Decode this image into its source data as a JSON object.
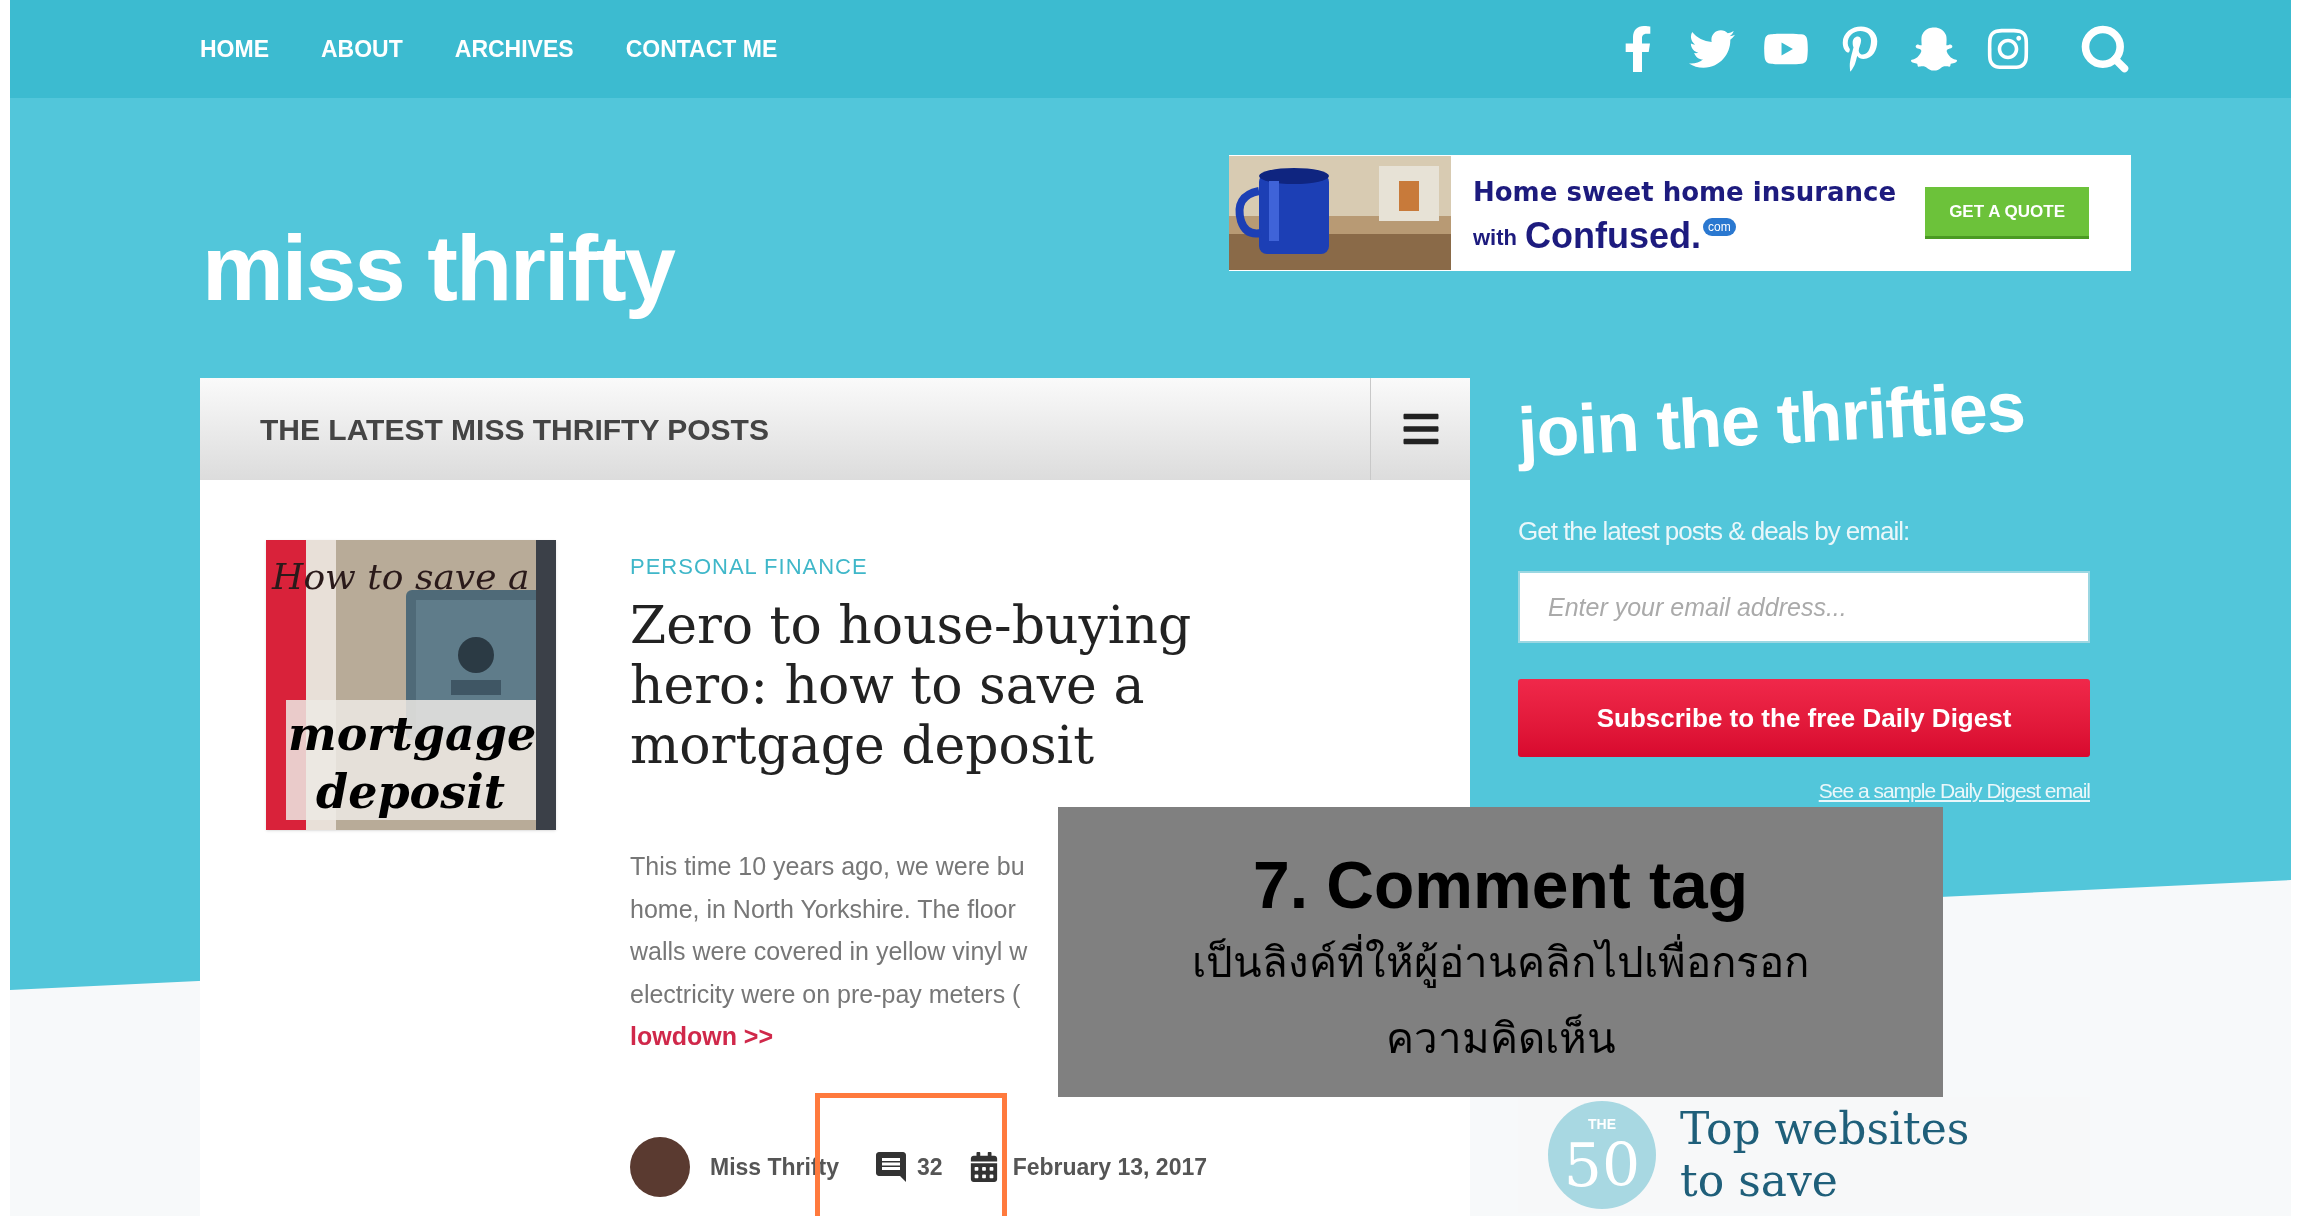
{
  "nav": {
    "links": [
      {
        "label": "HOME"
      },
      {
        "label": "ABOUT"
      },
      {
        "label": "ARCHIVES"
      },
      {
        "label": "CONTACT ME"
      }
    ]
  },
  "site": {
    "logo": "miss thrifty"
  },
  "ad": {
    "headline": "Home sweet home insurance",
    "brand_prefix": "with",
    "brand": "Confused.",
    "brand_badge": "com",
    "button": "GET A QUOTE"
  },
  "posts_panel": {
    "title": "THE LATEST MISS THRIFTY POSTS"
  },
  "post": {
    "thumbnail_text": [
      "How to save a",
      "mortgage",
      "deposit"
    ],
    "category": "PERSONAL FINANCE",
    "title_lines": [
      "Zero to house-buying",
      "hero: how to save a",
      "mortgage deposit"
    ],
    "excerpt_lines": [
      "This time 10 years ago, we were bu",
      "home, in North Yorkshire. The floor",
      "walls were covered in yellow vinyl w",
      "electricity were on pre-pay meters ("
    ],
    "read_more": "lowdown >>",
    "author": "Miss Thrifty",
    "comments": "32",
    "date": "February 13, 2017"
  },
  "sidebar": {
    "heading": "join the thrifties",
    "subheading": "Get the latest posts & deals by email:",
    "email_placeholder": "Enter your email address...",
    "button": "Subscribe to the free Daily Digest",
    "link": "See a sample Daily Digest email"
  },
  "promo": {
    "badge_small": "THE",
    "badge_number": "50",
    "lines": [
      "Top websites",
      "to save"
    ]
  },
  "annotation": {
    "title": "7. Comment tag",
    "body_lines": [
      "เป็นลิงค์ที่ให้ผู้อ่านคลิกไปเพื่อกรอก",
      "ความคิดเห็น"
    ]
  }
}
